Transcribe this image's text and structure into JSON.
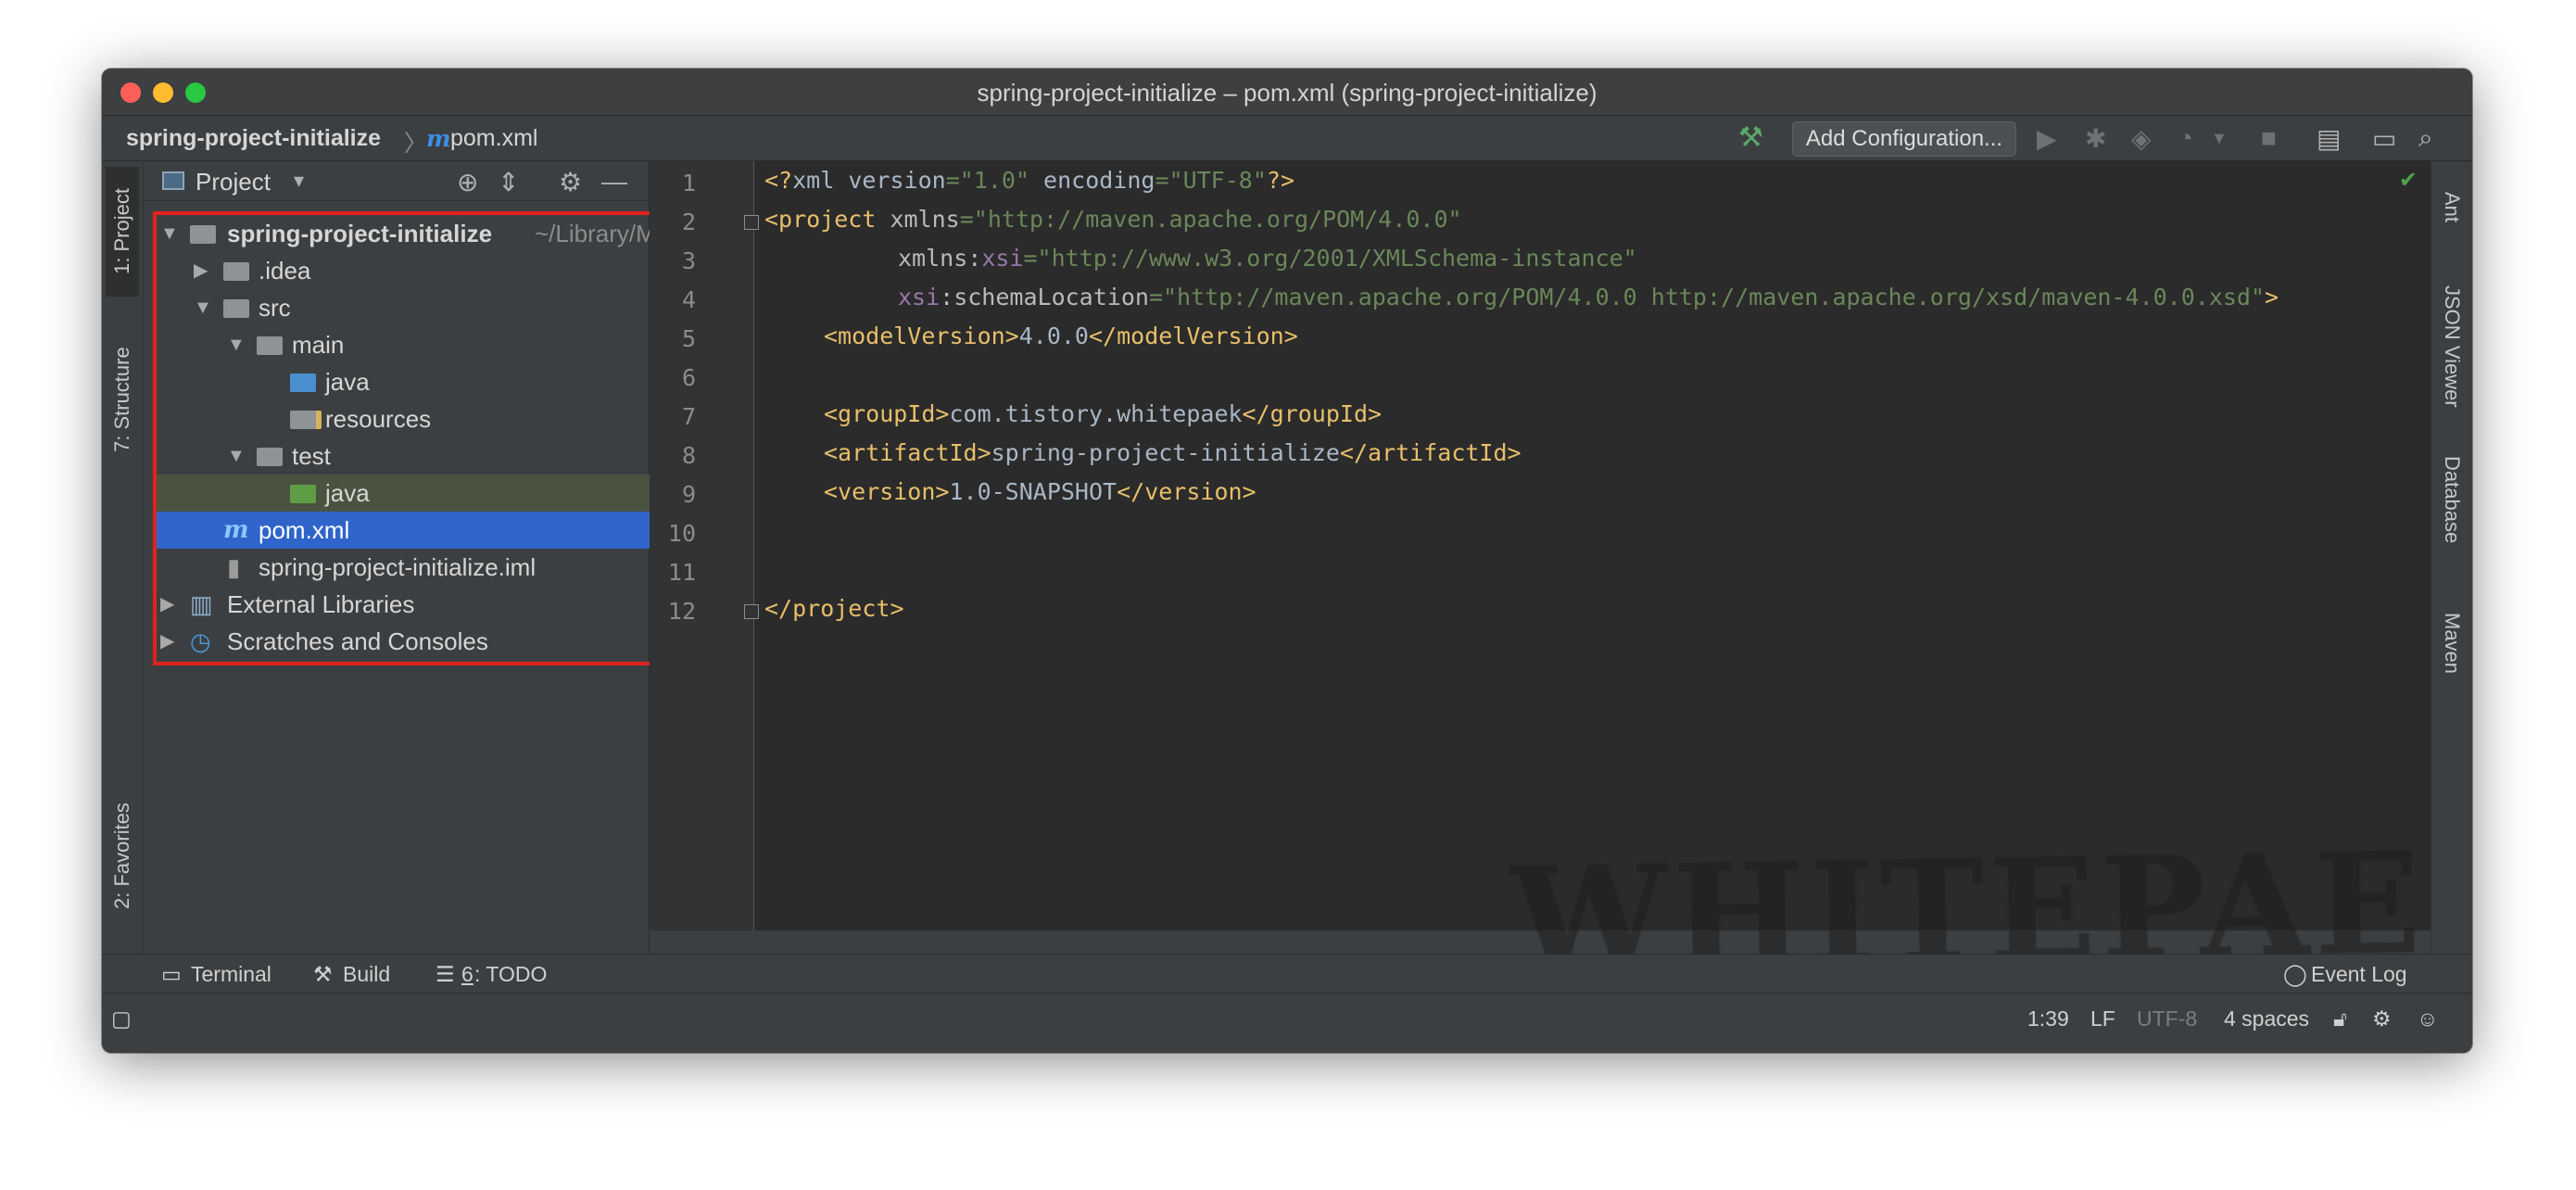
{
  "window": {
    "title": "spring-project-initialize – pom.xml (spring-project-initialize)"
  },
  "navbar": {
    "root": "spring-project-initialize",
    "separator": "〉",
    "file": "pom.xml",
    "add_configuration": "Add Configuration..."
  },
  "left_tabs": {
    "project": "1: Project",
    "structure": "7: Structure",
    "favorites": "2: Favorites"
  },
  "right_tabs": {
    "ant": "Ant",
    "json_viewer": "JSON Viewer",
    "database": "Database",
    "maven": "Maven"
  },
  "project_panel": {
    "title": "Project",
    "tree": {
      "root": {
        "label": "spring-project-initialize",
        "hint": "~/Library/M"
      },
      "idea": ".idea",
      "src": "src",
      "main": "main",
      "main_java": "java",
      "resources": "resources",
      "test": "test",
      "test_java": "java",
      "pom": "pom.xml",
      "iml": "spring-project-initialize.iml",
      "external_libraries": "External Libraries",
      "scratches": "Scratches and Consoles"
    }
  },
  "editor": {
    "line_numbers": [
      "1",
      "2",
      "3",
      "4",
      "5",
      "6",
      "7",
      "8",
      "9",
      "10",
      "11",
      "12"
    ],
    "code": {
      "l1_a": "<?",
      "l1_b": "xml version",
      "l1_c": "=\"1.0\"",
      "l1_d": " encoding",
      "l1_e": "=\"UTF-8\"",
      "l1_f": "?>",
      "l2_a": "<project",
      "l2_b": " xmlns",
      "l2_c": "=\"http://maven.apache.org/POM/4.0.0\"",
      "l3_a": "xmlns:",
      "l3_b": "xsi",
      "l3_c": "=\"http://www.w3.org/2001/XMLSchema-instance\"",
      "l4_a": "xsi",
      "l4_b": ":schemaLocation",
      "l4_c": "=\"http://maven.apache.org/POM/4.0.0 http://maven.apache.org/xsd/maven-4.0.0.xsd\"",
      "l4_d": ">",
      "l5_a": "<modelVersion>",
      "l5_b": "4.0.0",
      "l5_c": "</modelVersion>",
      "l7_a": "<groupId>",
      "l7_b": "com.tistory.whitepaek",
      "l7_c": "</groupId>",
      "l8_a": "<artifactId>",
      "l8_b": "spring-project-initialize",
      "l8_c": "</artifactId>",
      "l9_a": "<version>",
      "l9_b": "1.0-SNAPSHOT",
      "l9_c": "</version>",
      "l12_a": "</project>"
    },
    "watermark": "WHITEPAEK"
  },
  "tool_windows": {
    "terminal": "Terminal",
    "build": "Build",
    "todo_num": "6",
    "todo": ": TODO",
    "event_log": "Event Log"
  },
  "status_bar": {
    "position": "1:39",
    "line_sep": "LF",
    "encoding": "UTF-8",
    "indent": "4 spaces"
  },
  "colors": {
    "selection": "#2f65ca",
    "highlight_border": "#e0221d",
    "tag": "#e8bf6a",
    "string": "#6a8759"
  }
}
